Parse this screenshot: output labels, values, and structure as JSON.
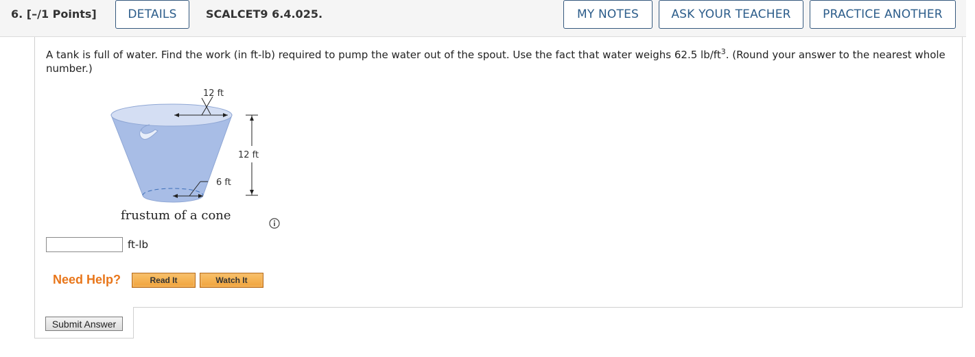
{
  "header": {
    "question_number": "6.",
    "points": "[–/1 Points]",
    "details_label": "DETAILS",
    "question_code": "SCALCET9 6.4.025.",
    "my_notes_label": "MY NOTES",
    "ask_teacher_label": "ASK YOUR TEACHER",
    "practice_another_label": "PRACTICE ANOTHER"
  },
  "question": {
    "text_before_exponent": "A tank is full of water. Find the work (in ft-lb) required to pump the water out of the spout. Use the fact that water weighs 62.5 lb/ft",
    "exponent": "3",
    "text_after_exponent": ". (Round your answer to the nearest whole number.)"
  },
  "figure": {
    "top_width_label": "12 ft",
    "height_label": "12 ft",
    "bottom_radius_label": "6 ft",
    "caption": "frustum of a cone"
  },
  "answer": {
    "value": "",
    "unit": "ft-lb"
  },
  "help": {
    "need_help_label": "Need Help?",
    "read_it_label": "Read It",
    "watch_it_label": "Watch It"
  },
  "submit": {
    "label": "Submit Answer"
  },
  "colors": {
    "header_button_border": "#34587d",
    "header_button_text": "#2b5c8a",
    "need_help": "#e8761a",
    "tank_fill": "#a8bde6"
  }
}
